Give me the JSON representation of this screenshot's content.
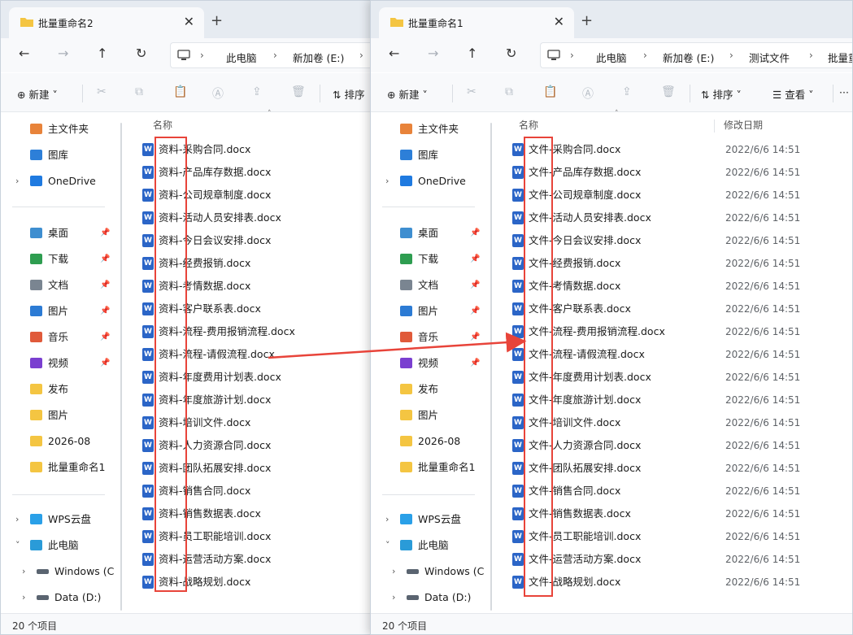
{
  "left": {
    "tab_title": "批量重命名2",
    "breadcrumb": [
      "此电脑",
      "新加卷 (E:)"
    ],
    "toolbar": {
      "new_label": "新建",
      "sort_label": "排序"
    },
    "column_name": "名称",
    "files": [
      "资料-采购合同.docx",
      "资料-产品库存数据.docx",
      "资料-公司规章制度.docx",
      "资料-活动人员安排表.docx",
      "资料-今日会议安排.docx",
      "资料-经费报销.docx",
      "资料-考情数据.docx",
      "资料-客户联系表.docx",
      "资料-流程-费用报销流程.docx",
      "资料-流程-请假流程.docx",
      "资料-年度费用计划表.docx",
      "资料-年度旅游计划.docx",
      "资料-培训文件.docx",
      "资料-人力资源合同.docx",
      "资料-团队拓展安排.docx",
      "资料-销售合同.docx",
      "资料-销售数据表.docx",
      "资料-员工职能培训.docx",
      "资料-运营活动方案.docx",
      "资料-战略规划.docx"
    ],
    "status": "20 个项目"
  },
  "right": {
    "tab_title": "批量重命名1",
    "breadcrumb": [
      "此电脑",
      "新加卷 (E:)",
      "测试文件",
      "批量重"
    ],
    "toolbar": {
      "new_label": "新建",
      "sort_label": "排序",
      "view_label": "查看"
    },
    "column_name": "名称",
    "column_date": "修改日期",
    "files": [
      "文件-采购合同.docx",
      "文件-产品库存数据.docx",
      "文件-公司规章制度.docx",
      "文件-活动人员安排表.docx",
      "文件-今日会议安排.docx",
      "文件-经费报销.docx",
      "文件-考情数据.docx",
      "文件-客户联系表.docx",
      "文件-流程-费用报销流程.docx",
      "文件-流程-请假流程.docx",
      "文件-年度费用计划表.docx",
      "文件-年度旅游计划.docx",
      "文件-培训文件.docx",
      "文件-人力资源合同.docx",
      "文件-团队拓展安排.docx",
      "文件-销售合同.docx",
      "文件-销售数据表.docx",
      "文件-员工职能培训.docx",
      "文件-运营活动方案.docx",
      "文件-战略规划.docx"
    ],
    "date": "2022/6/6 14:51",
    "status": "20 个项目"
  },
  "sidebar": [
    {
      "label": "主文件夹",
      "icon": "home-icon"
    },
    {
      "label": "图库",
      "icon": "gallery-icon"
    },
    {
      "label": "OneDrive",
      "icon": "onedrive-icon"
    },
    {
      "label": "桌面",
      "icon": "desktop-icon"
    },
    {
      "label": "下载",
      "icon": "download-icon"
    },
    {
      "label": "文档",
      "icon": "documents-icon"
    },
    {
      "label": "图片",
      "icon": "pictures-icon"
    },
    {
      "label": "音乐",
      "icon": "music-icon"
    },
    {
      "label": "视频",
      "icon": "videos-icon"
    },
    {
      "label": "发布",
      "icon": "folder-icon"
    },
    {
      "label": "图片",
      "icon": "folder-icon"
    },
    {
      "label": "2026-08",
      "icon": "folder-icon"
    },
    {
      "label": "批量重命名1",
      "icon": "folder-icon"
    },
    {
      "label": "WPS云盘",
      "icon": "wps-cloud-icon"
    },
    {
      "label": "此电脑",
      "icon": "this-pc-icon"
    },
    {
      "label": "Windows (C",
      "icon": "drive-icon"
    },
    {
      "label": "Data (D:)",
      "icon": "drive-icon"
    }
  ],
  "colors": {
    "highlight": "#e8443a",
    "word_blue": "#2b65c7",
    "folder": "#f4c542"
  }
}
